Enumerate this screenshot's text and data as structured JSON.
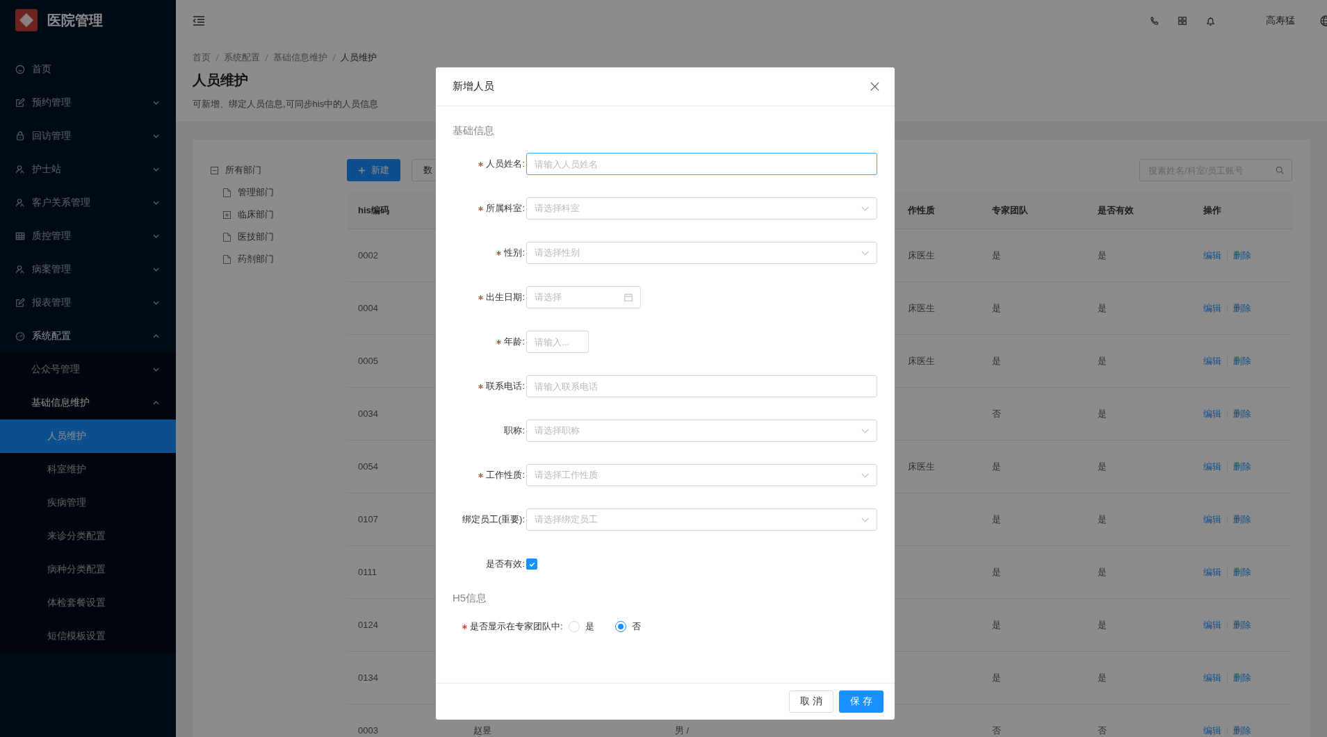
{
  "app": {
    "title": "医院管理"
  },
  "sidebar": {
    "items": [
      {
        "label": "首页",
        "selected": false
      },
      {
        "label": "预约管理",
        "expanded": false,
        "selected": false
      },
      {
        "label": "回访管理",
        "expanded": false,
        "selected": false
      },
      {
        "label": "护士站",
        "expanded": false,
        "selected": false
      },
      {
        "label": "客户关系管理",
        "expanded": false,
        "selected": false
      },
      {
        "label": "质控管理",
        "expanded": false,
        "selected": false
      },
      {
        "label": "病案管理",
        "expanded": false,
        "selected": false
      },
      {
        "label": "报表管理",
        "expanded": false,
        "selected": false
      },
      {
        "label": "系统配置",
        "expanded": true,
        "selected": false,
        "children": [
          {
            "label": "公众号管理",
            "expanded": false,
            "selected": false
          },
          {
            "label": "基础信息维护",
            "expanded": true,
            "selected": false,
            "children": [
              {
                "label": "人员维护",
                "selected": true
              },
              {
                "label": "科室维护",
                "selected": false
              },
              {
                "label": "疾病管理",
                "selected": false
              },
              {
                "label": "来诊分类配置",
                "selected": false
              },
              {
                "label": "病种分类配置",
                "selected": false
              },
              {
                "label": "体检套餐设置",
                "selected": false
              },
              {
                "label": "短信模板设置",
                "selected": false
              }
            ]
          }
        ]
      }
    ]
  },
  "header": {
    "user": "高寿猛"
  },
  "breadcrumb": [
    "首页",
    "系统配置",
    "基础信息维护",
    "人员维护"
  ],
  "page": {
    "title": "人员维护",
    "description": "可新增、绑定人员信息,可同步his中的人员信息"
  },
  "tree": {
    "label": "所有部门",
    "expanded": true,
    "children": [
      {
        "label": "管理部门",
        "kind": "leaf"
      },
      {
        "label": "临床部门",
        "kind": "folder",
        "expanded": false
      },
      {
        "label": "医技部门",
        "kind": "leaf"
      },
      {
        "label": "药剂部门",
        "kind": "leaf"
      }
    ]
  },
  "toolbar": {
    "buttons": [
      {
        "label": "新建",
        "kind": "primary"
      },
      {
        "label": "数",
        "kind": "default"
      }
    ],
    "search": {
      "placeholder": "搜素姓名/科室/员工账号"
    }
  },
  "table": {
    "columns": [
      "his编码",
      "作性质",
      "专家团队",
      "是否有效",
      "操作"
    ],
    "rows": [
      {
        "his_code": "0002",
        "work_type": "床医生",
        "expert_team": "是",
        "valid": "是",
        "actions": [
          "编辑",
          "删除"
        ]
      },
      {
        "his_code": "0004",
        "work_type": "床医生",
        "expert_team": "是",
        "valid": "是",
        "actions": [
          "编辑",
          "删除"
        ]
      },
      {
        "his_code": "0005",
        "work_type": "床医生",
        "expert_team": "是",
        "valid": "是",
        "actions": [
          "编辑",
          "删除"
        ]
      },
      {
        "his_code": "0034",
        "expert_team": "否",
        "valid": "是",
        "actions": [
          "编辑",
          "删除"
        ]
      },
      {
        "his_code": "0054",
        "work_type": "床医生",
        "expert_team": "是",
        "valid": "是",
        "actions": [
          "编辑",
          "删除"
        ]
      },
      {
        "his_code": "0107",
        "expert_team": "是",
        "valid": "是",
        "actions": [
          "编辑",
          "删除"
        ]
      },
      {
        "his_code": "0111",
        "expert_team": "是",
        "valid": "是",
        "actions": [
          "编辑",
          "删除"
        ]
      },
      {
        "his_code": "0124",
        "expert_team": "是",
        "valid": "是",
        "actions": [
          "编辑",
          "删除"
        ]
      },
      {
        "his_code": "0134",
        "expert_team": "是",
        "valid": "是",
        "actions": [
          "编辑",
          "删除"
        ]
      },
      {
        "his_code": "0003",
        "name": "赵昱",
        "gender": "男 /",
        "expert_team": "否",
        "valid": "否",
        "actions": [
          "编辑",
          "删除"
        ]
      }
    ]
  },
  "dialog": {
    "title": "新增人员",
    "sections": [
      {
        "title": "基础信息",
        "fields": [
          {
            "label": "人员姓名:",
            "kind": "text",
            "required": true,
            "focused": true,
            "placeholder": "请输入人员姓名"
          },
          {
            "label": "所属科室:",
            "kind": "select",
            "required": true,
            "focused": false,
            "placeholder": "请选择科室"
          },
          {
            "label": "性别:",
            "kind": "select",
            "required": true,
            "focused": false,
            "placeholder": "请选择性别"
          },
          {
            "label": "出生日期:",
            "kind": "date",
            "required": true,
            "focused": false,
            "placeholder": "请选择"
          },
          {
            "label": "年龄:",
            "kind": "short",
            "required": true,
            "focused": false,
            "placeholder": "请输入..."
          },
          {
            "label": "联系电话:",
            "kind": "text",
            "required": true,
            "focused": false,
            "placeholder": "请输入联系电话"
          },
          {
            "label": "职称:",
            "kind": "select",
            "required": false,
            "focused": false,
            "placeholder": "请选择职称"
          },
          {
            "label": "工作性质:",
            "kind": "select",
            "required": true,
            "focused": false,
            "placeholder": "请选择工作性质"
          },
          {
            "label": "绑定员工(重要):",
            "kind": "select",
            "required": false,
            "focused": false,
            "placeholder": "请选择绑定员工"
          },
          {
            "label": "是否有效:",
            "kind": "checkbox",
            "required": false,
            "checked": true
          }
        ]
      },
      {
        "title": "H5信息",
        "fields": [
          {
            "label": "是否显示在专家团队中:",
            "kind": "radio",
            "required": true,
            "options": [
              {
                "label": "是",
                "selected": false
              },
              {
                "label": "否",
                "selected": true
              }
            ]
          }
        ]
      }
    ],
    "buttons": [
      {
        "label": "取 消",
        "kind": "default"
      },
      {
        "label": "保 存",
        "kind": "primary"
      }
    ]
  }
}
